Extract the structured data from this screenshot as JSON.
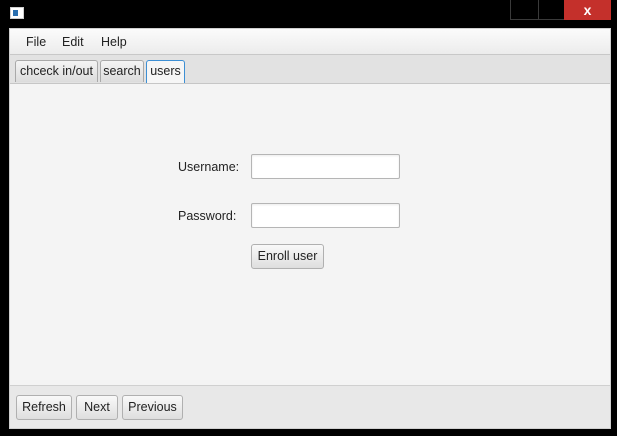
{
  "menu": {
    "items": [
      {
        "label": "File"
      },
      {
        "label": "Edit"
      },
      {
        "label": "Help"
      }
    ]
  },
  "tabs": [
    {
      "label": "chceck in/out",
      "active": false
    },
    {
      "label": "search",
      "active": false
    },
    {
      "label": "users",
      "active": true
    }
  ],
  "form": {
    "username_label": "Username:",
    "username_value": "",
    "password_label": "Password:",
    "password_value": "",
    "enroll_label": "Enroll user"
  },
  "bottom": {
    "refresh_label": "Refresh",
    "next_label": "Next",
    "previous_label": "Previous"
  },
  "window": {
    "close_glyph": "x",
    "close_color": "#c4302b"
  }
}
